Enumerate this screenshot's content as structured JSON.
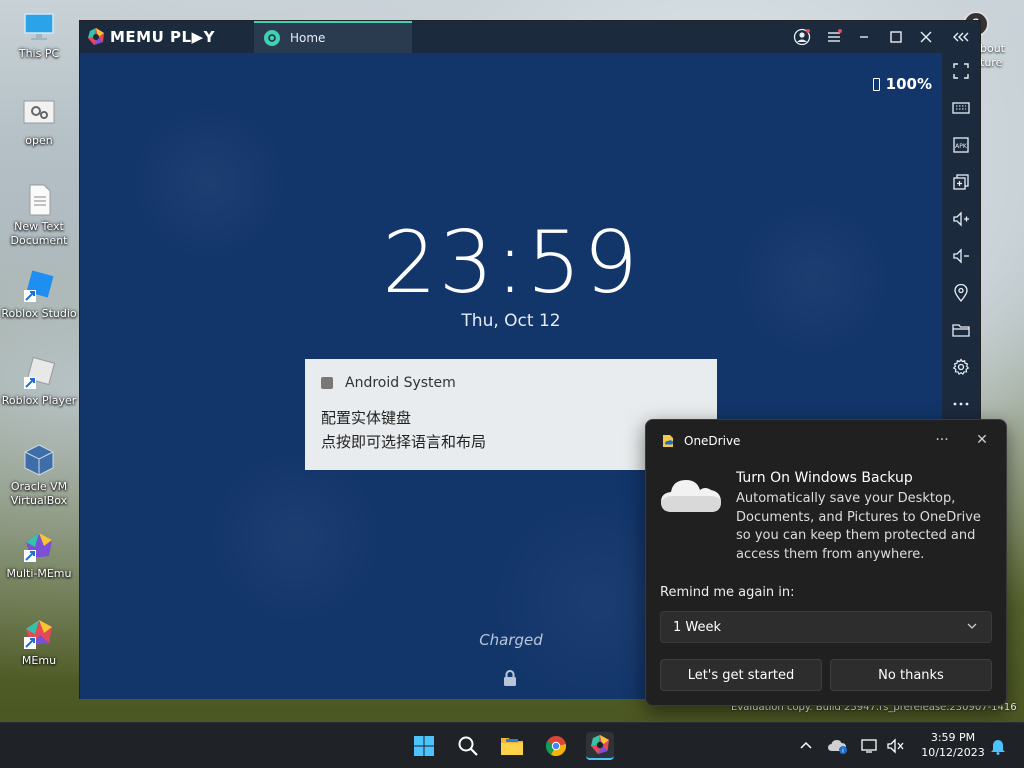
{
  "desktop": {
    "icons": [
      {
        "label": "This PC"
      },
      {
        "label": "open"
      },
      {
        "label": "New Text Document"
      },
      {
        "label": "Roblox Studio"
      },
      {
        "label": "Roblox Player"
      },
      {
        "label": "Oracle VM VirtualBox"
      },
      {
        "label": "Multi-MEmu"
      },
      {
        "label": "MEmu"
      }
    ],
    "partial_icon_label_1": "bout",
    "partial_icon_label_2": "ture",
    "evaluation_text": "Evaluation copy. Build 25947.rs_prerelease.230907-1416"
  },
  "memu": {
    "logo_text": "MEMU PL▶Y",
    "tab_label": "Home",
    "battery": "100%",
    "time": "23:59",
    "date": "Thu, Oct 12",
    "notification": {
      "app": "Android System",
      "line1": "配置实体键盘",
      "line2": "点按即可选择语言和布局"
    },
    "charged": "Charged"
  },
  "onedrive": {
    "app": "OneDrive",
    "more": "···",
    "close": "✕",
    "title": "Turn On Windows Backup",
    "body": "Automatically save your Desktop, Documents, and Pictures to OneDrive so you can keep them protected and access them from anywhere.",
    "remind_label": "Remind me again in:",
    "remind_value": "1 Week",
    "start_button": "Let's get started",
    "no_button": "No thanks"
  },
  "taskbar": {
    "time": "3:59 PM",
    "date": "10/12/2023"
  },
  "colors": {
    "memu_accent": "#3fd0b6",
    "android_bg": "#12356a",
    "popup_bg": "#202020",
    "taskbar_bg": "#1f2327"
  }
}
